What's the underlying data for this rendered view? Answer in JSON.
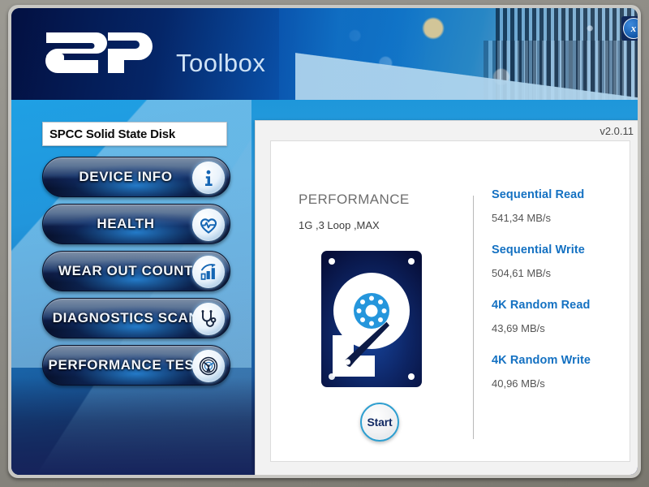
{
  "window": {
    "close_label": "x",
    "close_icon": "close-circle-icon"
  },
  "header": {
    "brand_logo": "sp-logo-icon",
    "title": "Toolbox"
  },
  "sidebar": {
    "device_select": {
      "value": "SPCC Solid State Disk"
    },
    "items": [
      {
        "label": "DEVICE INFO",
        "icon": "info-icon"
      },
      {
        "label": "HEALTH",
        "icon": "heart-pulse-icon"
      },
      {
        "label": "WEAR OUT COUNT",
        "icon": "bar-chart-arrow-icon"
      },
      {
        "label": "DIAGNOSTICS SCAN",
        "icon": "stethoscope-icon"
      },
      {
        "label": "PERFORMANCE TEST",
        "icon": "speedometer-icon"
      }
    ]
  },
  "main": {
    "version": "v2.0.11",
    "section_title": "PERFORMANCE",
    "test_config": "1G ,3 Loop ,MAX",
    "disk_icon": "hard-disk-icon",
    "start_button": "Start",
    "results": [
      {
        "label": "Sequential Read",
        "value": "541,34 MB/s"
      },
      {
        "label": "Sequential Write",
        "value": "504,61 MB/s"
      },
      {
        "label": "4K Random Read",
        "value": "43,69 MB/s"
      },
      {
        "label": "4K Random Write",
        "value": "40,96 MB/s"
      }
    ]
  },
  "colors": {
    "accent_blue": "#1471c2",
    "header_dark": "#031041",
    "panel_bg": "#f2f2f2",
    "nav_dark": "#0d1c45"
  }
}
